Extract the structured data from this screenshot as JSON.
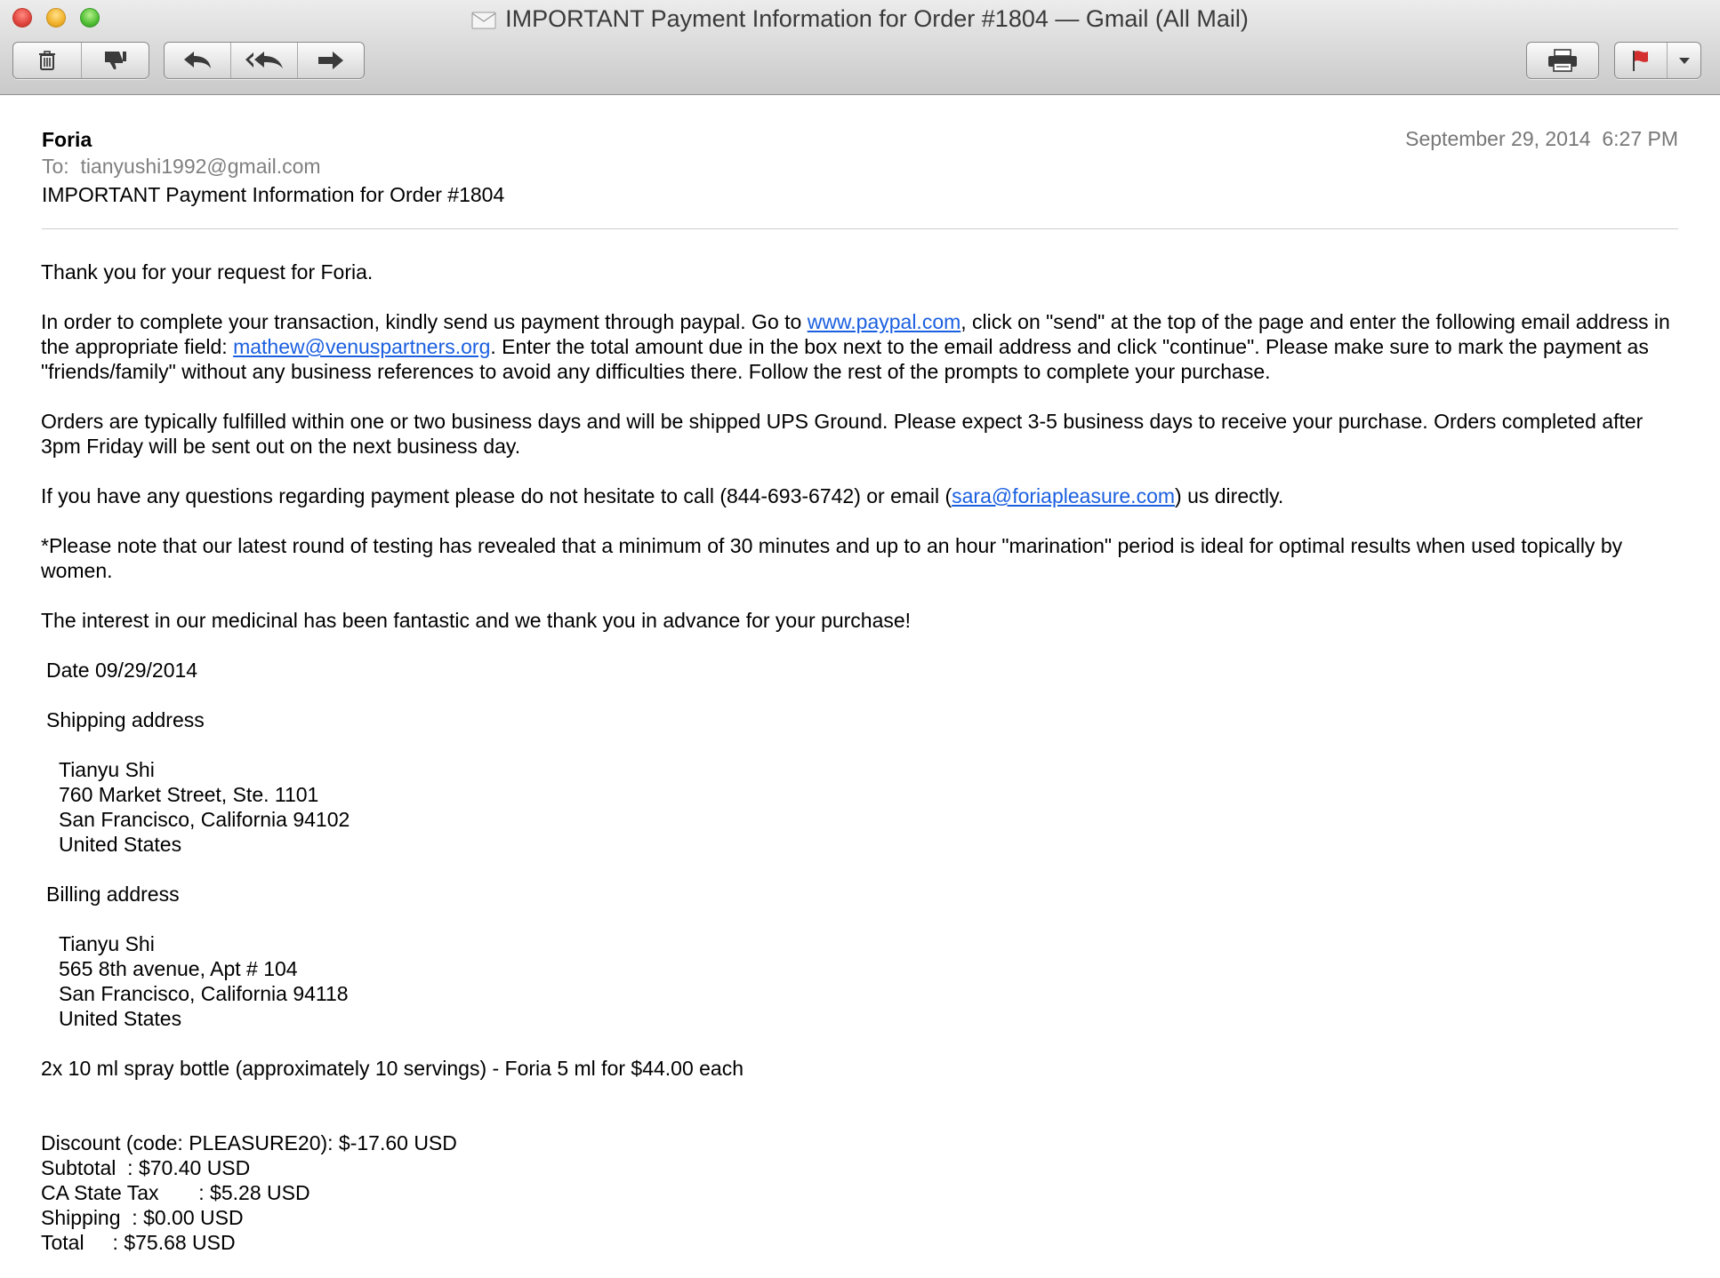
{
  "window": {
    "title": "IMPORTANT Payment Information for Order #1804 — Gmail (All Mail)"
  },
  "toolbar": {
    "icons": [
      "trash-icon",
      "junk-thumbs-down-icon",
      "reply-icon",
      "reply-all-icon",
      "forward-icon",
      "print-icon",
      "flag-icon",
      "dropdown-arrow-icon"
    ],
    "flag_color": "#d32f2f"
  },
  "message": {
    "from": "Foria",
    "to_label": "To:",
    "to_address": "tianyushi1992@gmail.com",
    "subject": "IMPORTANT Payment Information for Order #1804",
    "date": "September 29, 2014",
    "time": "6:27 PM"
  },
  "body": {
    "greeting": "Thank you for your request for Foria.",
    "para1_a": "In order to complete your transaction, kindly send us payment through paypal. Go to ",
    "para1_link1": "www.paypal.com",
    "para1_b": ", click on \"send\" at the top of the page and enter the following email address in the appropriate field: ",
    "para1_link2": "mathew@venuspartners.org",
    "para1_c": ". Enter the total amount due in the box next to the email address and click \"continue\". Please make sure to mark the payment as \"friends/family\" without any business references to avoid any difficulties there. Follow the rest of the prompts to complete your purchase.",
    "para2": "Orders are typically fulfilled within one or two business days and will be shipped UPS Ground. Please expect 3-5 business days to receive your purchase. Orders completed after 3pm Friday will be sent out on the next business day.",
    "para3_a": "If you have any questions regarding payment please do not hesitate to call (844-693-6742) or email (",
    "para3_link": "sara@foriapleasure.com",
    "para3_b": ") us directly.",
    "para4": "*Please note that our latest round of testing has revealed that a minimum of 30 minutes and up to an hour \"marination\" period is ideal for optimal results when used topically by women.",
    "para5": "The interest in our medicinal has been fantastic and we thank you in advance for your purchase!",
    "date_line": "Date 09/29/2014",
    "shipping_heading": "Shipping address",
    "shipping": [
      "Tianyu Shi",
      "760 Market Street, Ste. 1101",
      "San Francisco, California  94102",
      "United States"
    ],
    "billing_heading": "Billing address",
    "billing": [
      "Tianyu Shi",
      "565 8th avenue, Apt # 104",
      "San Francisco, California  94118",
      "United States"
    ],
    "item": "2x 10 ml spray bottle (approximately 10 servings) - Foria 5 ml for $44.00 each",
    "totals": [
      "Discount (code: PLEASURE20): $-17.60 USD",
      "Subtotal  : $70.40 USD",
      "CA State Tax       : $5.28 USD",
      "Shipping  : $0.00 USD",
      "Total     : $75.68 USD"
    ],
    "link_color": "#1a5fe0"
  }
}
